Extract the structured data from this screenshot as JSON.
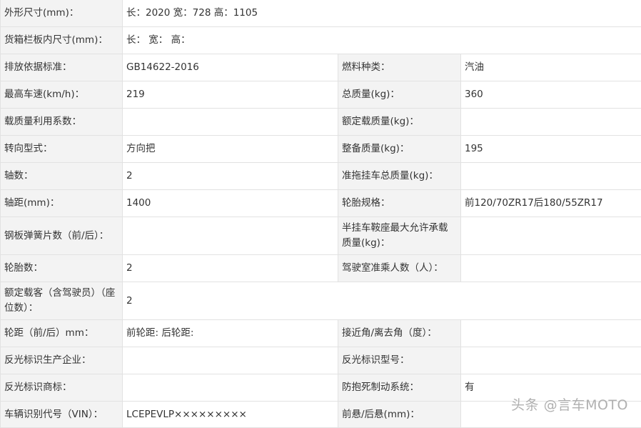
{
  "rows": {
    "r1": {
      "label": "外形尺寸(mm)：",
      "value": "长：2020 宽：728 高：1105"
    },
    "r2": {
      "label": "货箱栏板内尺寸(mm)：",
      "value": "长： 宽： 高："
    },
    "r3": {
      "l1": "排放依据标准：",
      "v1": "GB14622-2016",
      "l2": "燃料种类：",
      "v2": "汽油"
    },
    "r4": {
      "l1": "最高车速(km/h)：",
      "v1": "219",
      "l2": "总质量(kg)：",
      "v2": "360"
    },
    "r5": {
      "l1": "载质量利用系数：",
      "v1": "",
      "l2": "额定载质量(kg)：",
      "v2": ""
    },
    "r6": {
      "l1": "转向型式：",
      "v1": "方向把",
      "l2": "整备质量(kg)：",
      "v2": "195"
    },
    "r7": {
      "l1": "轴数：",
      "v1": "2",
      "l2": "准拖挂车总质量(kg)：",
      "v2": ""
    },
    "r8": {
      "l1": "轴距(mm)：",
      "v1": "1400",
      "l2": "轮胎规格：",
      "v2": "前120/70ZR17后180/55ZR17"
    },
    "r9": {
      "l1": "钢板弹簧片数（前/后）：",
      "v1": "",
      "l2": "半挂车鞍座最大允许承载质量(kg)：",
      "v2": ""
    },
    "r10": {
      "l1": "轮胎数：",
      "v1": "2",
      "l2": "驾驶室准乘人数（人）：",
      "v2": ""
    },
    "r11": {
      "label": "额定载客（含驾驶员）（座位数）：",
      "value": "2"
    },
    "r12": {
      "l1": "轮距（前/后）mm：",
      "v1": "前轮距: 后轮距:",
      "l2": "接近角/离去角（度）：",
      "v2": ""
    },
    "r13": {
      "l1": "反光标识生产企业：",
      "v1": "",
      "l2": "反光标识型号：",
      "v2": ""
    },
    "r14": {
      "l1": "反光标识商标：",
      "v1": "",
      "l2": "防抱死制动系统：",
      "v2": "有"
    },
    "r15": {
      "l1": "车辆识别代号（VIN）：",
      "v1": "LCEPEVLP×××××××××",
      "l2": "前悬/后悬(mm)：",
      "v2": ""
    }
  },
  "watermark": "头条 @言车MOTO"
}
